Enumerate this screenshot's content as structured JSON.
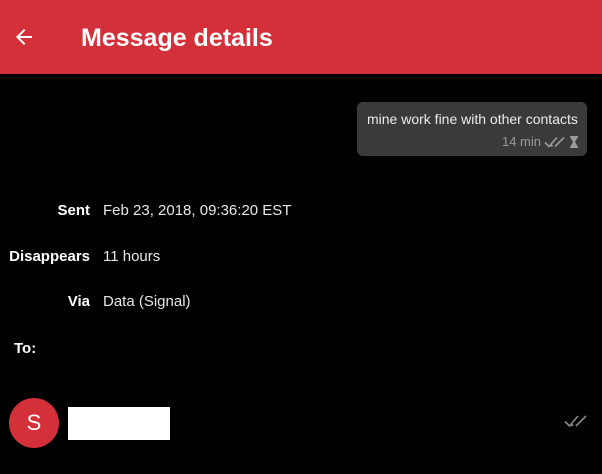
{
  "header": {
    "title": "Message details",
    "back_icon": "arrow-left-icon",
    "background_color": "#d4303a"
  },
  "message": {
    "text": "mine work fine with other contacts",
    "time": "14 min",
    "status_icon": "double-check-icon",
    "timer_icon": "hourglass-icon"
  },
  "details": [
    {
      "label": "Sent",
      "value": "Feb 23, 2018, 09:36:20 EST"
    },
    {
      "label": "Disappears",
      "value": "11 hours"
    },
    {
      "label": "Via",
      "value": "Data (Signal)"
    }
  ],
  "recipients": {
    "label": "To:",
    "items": [
      {
        "avatar_letter": "S",
        "status_icon": "double-check-icon"
      }
    ]
  }
}
